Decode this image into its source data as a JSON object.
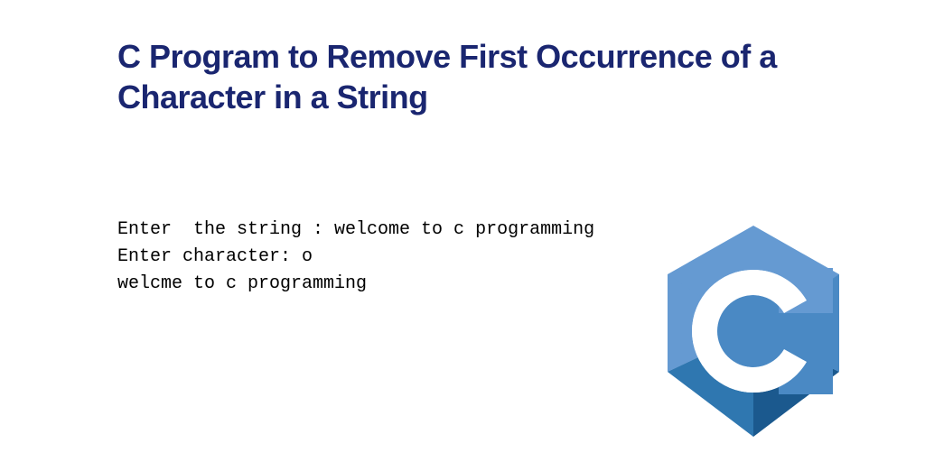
{
  "title": "C Program to Remove First Occurrence of a Character in a String",
  "code": {
    "line1": "Enter  the string : welcome to c programming",
    "line2": "Enter character: o",
    "line3": "welcme to c programming"
  }
}
